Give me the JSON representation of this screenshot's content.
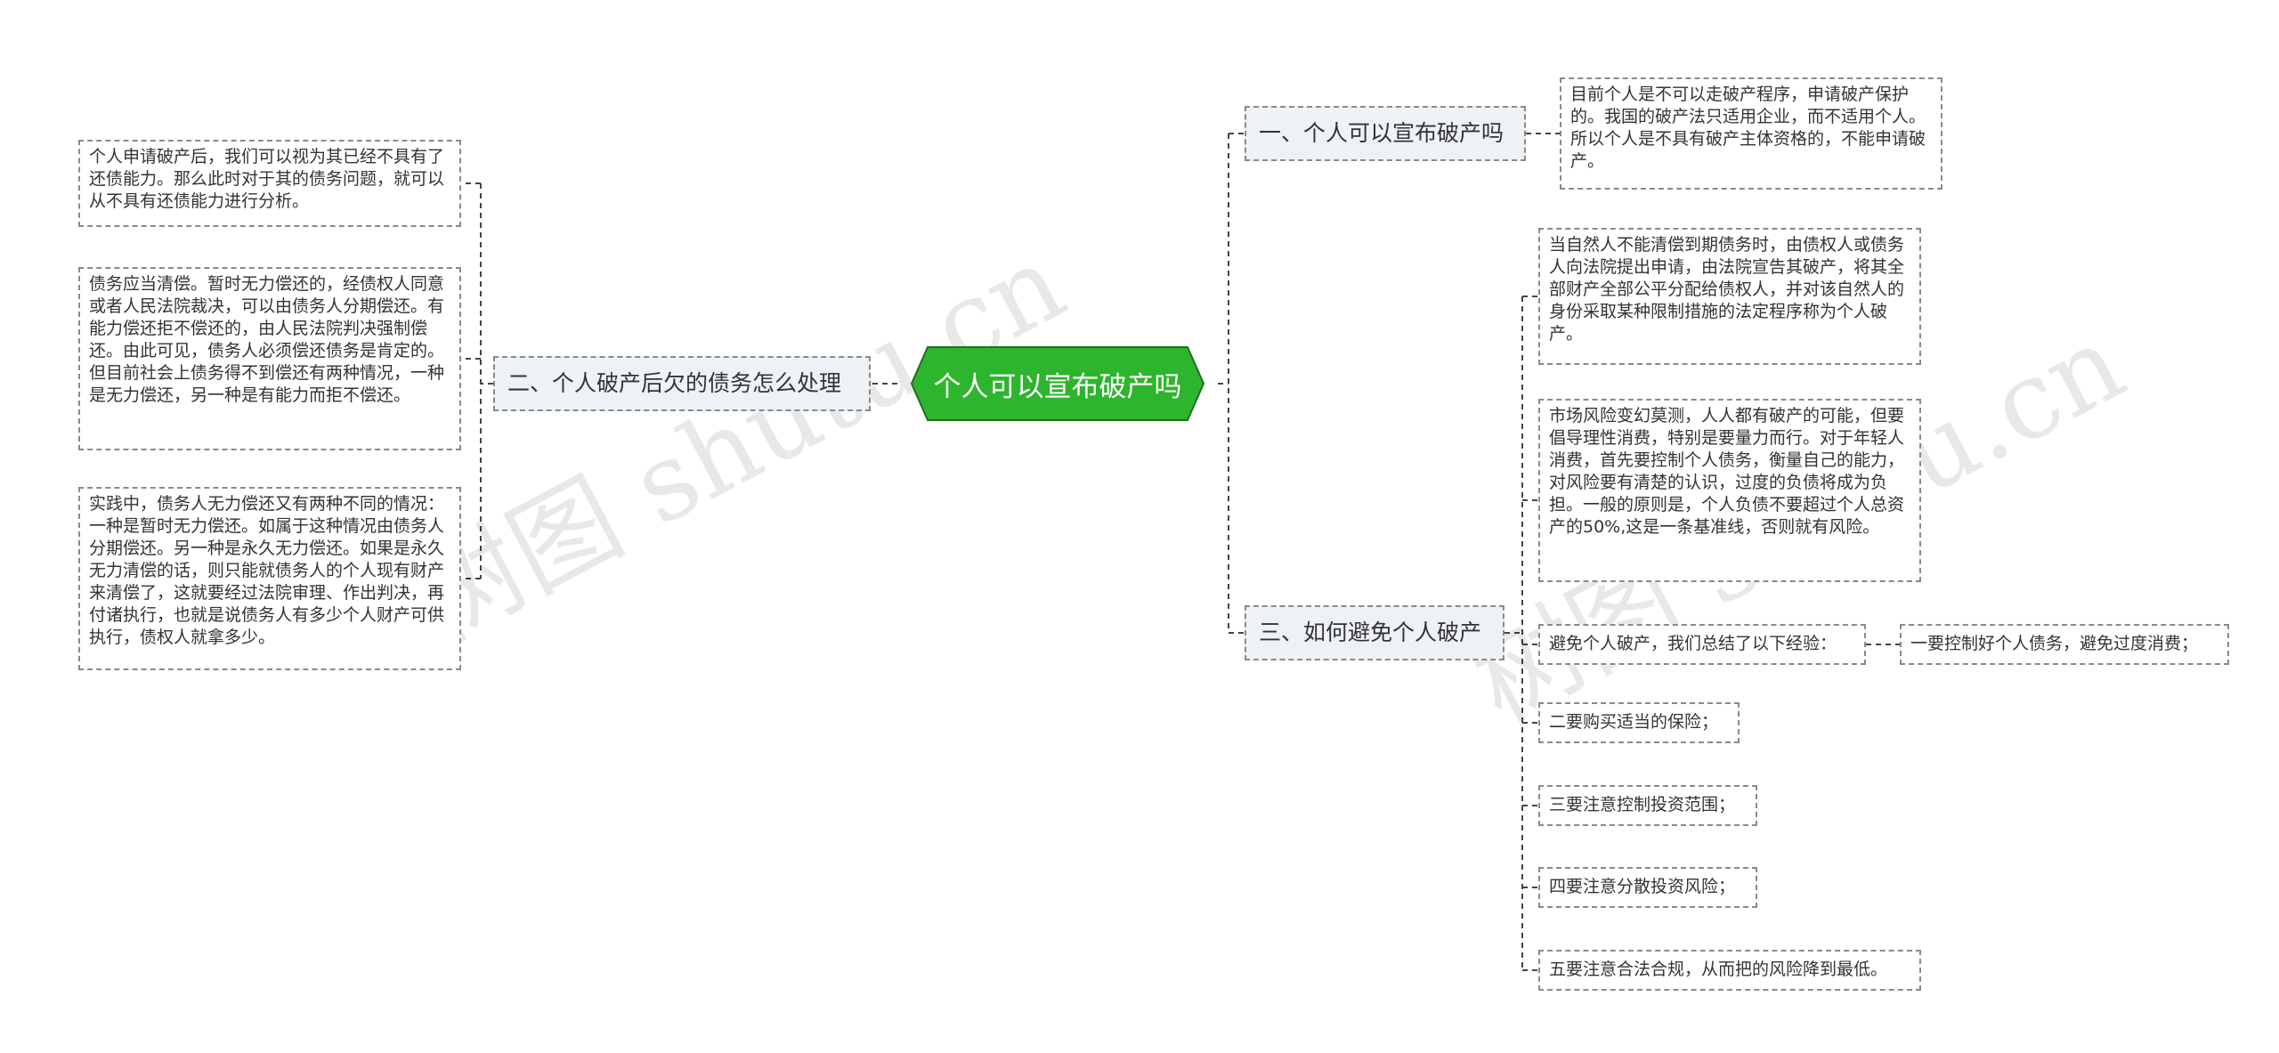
{
  "root": {
    "label": "个人可以宣布破产吗",
    "color": "#2db52d",
    "border": "#1f6f1f"
  },
  "branches": {
    "b1": {
      "label": "一、个人可以宣布破产吗",
      "leaves": [
        "目前个人是不可以走破产程序，申请破产保护的。我国的破产法只适用企业，而不适用个人。所以个人是不具有破产主体资格的，不能申请破产。"
      ]
    },
    "b2": {
      "label": "二、个人破产后欠的债务怎么处理",
      "leaves": [
        "个人申请破产后，我们可以视为其已经不具有了还债能力。那么此时对于其的债务问题，就可以从不具有还债能力进行分析。",
        "债务应当清偿。暂时无力偿还的，经债权人同意或者人民法院裁决，可以由债务人分期偿还。有能力偿还拒不偿还的，由人民法院判决强制偿还。由此可见，债务人必须偿还债务是肯定的。但目前社会上债务得不到偿还有两种情况，一种是无力偿还，另一种是有能力而拒不偿还。",
        "实践中，债务人无力偿还又有两种不同的情况：一种是暂时无力偿还。如属于这种情况由债务人分期偿还。另一种是永久无力偿还。如果是永久无力清偿的话，则只能就债务人的个人现有财产来清偿了，这就要经过法院审理、作出判决，再付诸执行，也就是说债务人有多少个人财产可供执行，债权人就拿多少。"
      ]
    },
    "b3": {
      "label": "三、如何避免个人破产",
      "leaves": [
        "当自然人不能清偿到期债务时，由债权人或债务人向法院提出申请，由法院宣告其破产，将其全部财产全部公平分配给债权人，并对该自然人的身份采取某种限制措施的法定程序称为个人破产。",
        "市场风险变幻莫测，人人都有破产的可能，但要倡导理性消费，特别是要量力而行。对于年轻人消费，首先要控制个人债务，衡量自己的能力，对风险要有清楚的认识，过度的负债将成为负担。一般的原则是，个人负债不要超过个人总资产的50%,这是一条基准线，否则就有风险。",
        "避免个人破产，我们总结了以下经验：",
        "二要购买适当的保险；",
        "三要注意控制投资范围；",
        "四要注意分散投资风险；",
        "五要注意合法合规，从而把的风险降到最低。"
      ],
      "sub_leaf": "一要控制好个人债务，避免过度消费；"
    }
  },
  "watermarks": [
    "树图 shutu.cn",
    "树图 shutu.cn"
  ]
}
